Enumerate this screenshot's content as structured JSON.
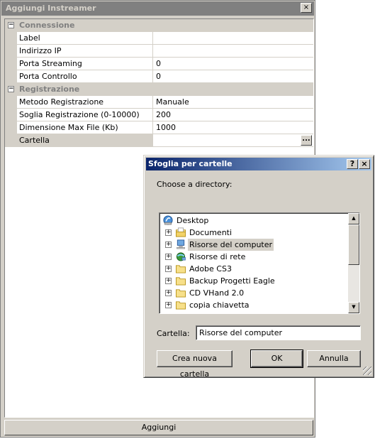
{
  "main_window": {
    "title": "Aggiungi Instreamer",
    "close_glyph": "×",
    "categories": [
      {
        "expander": "−",
        "label": "Connessione",
        "rows": [
          {
            "name": "Label",
            "value": ""
          },
          {
            "name": "Indirizzo IP",
            "value": ""
          },
          {
            "name": "Porta Streaming",
            "value": "0"
          },
          {
            "name": "Porta Controllo",
            "value": "0"
          }
        ]
      },
      {
        "expander": "−",
        "label": "Registrazione",
        "rows": [
          {
            "name": "Metodo Registrazione",
            "value": "Manuale"
          },
          {
            "name": "Soglia Registrazione (0-10000)",
            "value": "200"
          },
          {
            "name": "Dimensione Max File (Kb)",
            "value": "1000"
          },
          {
            "name": "Cartella",
            "value": "",
            "button": "..."
          }
        ]
      }
    ],
    "action_button": "Aggiungi"
  },
  "browse_dialog": {
    "title": "Sfoglia per cartelle",
    "help_glyph": "?",
    "close_glyph": "×",
    "prompt": "Choose a directory:",
    "tree": [
      {
        "label": "Desktop",
        "icon": "desktop-icon",
        "expander": "",
        "level": 0
      },
      {
        "label": "Documenti",
        "icon": "documents-folder-icon",
        "expander": "+",
        "level": 1
      },
      {
        "label": "Risorse del computer",
        "icon": "computer-icon",
        "expander": "+",
        "level": 1,
        "selected": true
      },
      {
        "label": "Risorse di rete",
        "icon": "network-icon",
        "expander": "+",
        "level": 1
      },
      {
        "label": "Adobe CS3",
        "icon": "folder-icon",
        "expander": "+",
        "level": 1
      },
      {
        "label": "Backup Progetti Eagle",
        "icon": "folder-icon",
        "expander": "+",
        "level": 1
      },
      {
        "label": "CD VHand 2.0",
        "icon": "folder-icon",
        "expander": "+",
        "level": 1
      },
      {
        "label": "copia chiavetta",
        "icon": "folder-icon",
        "expander": "+",
        "level": 1
      }
    ],
    "folder_label": "Cartella:",
    "folder_value": "Risorse del computer",
    "buttons": {
      "new_folder": "Crea nuova cartella",
      "ok": "OK",
      "cancel": "Annulla"
    }
  }
}
